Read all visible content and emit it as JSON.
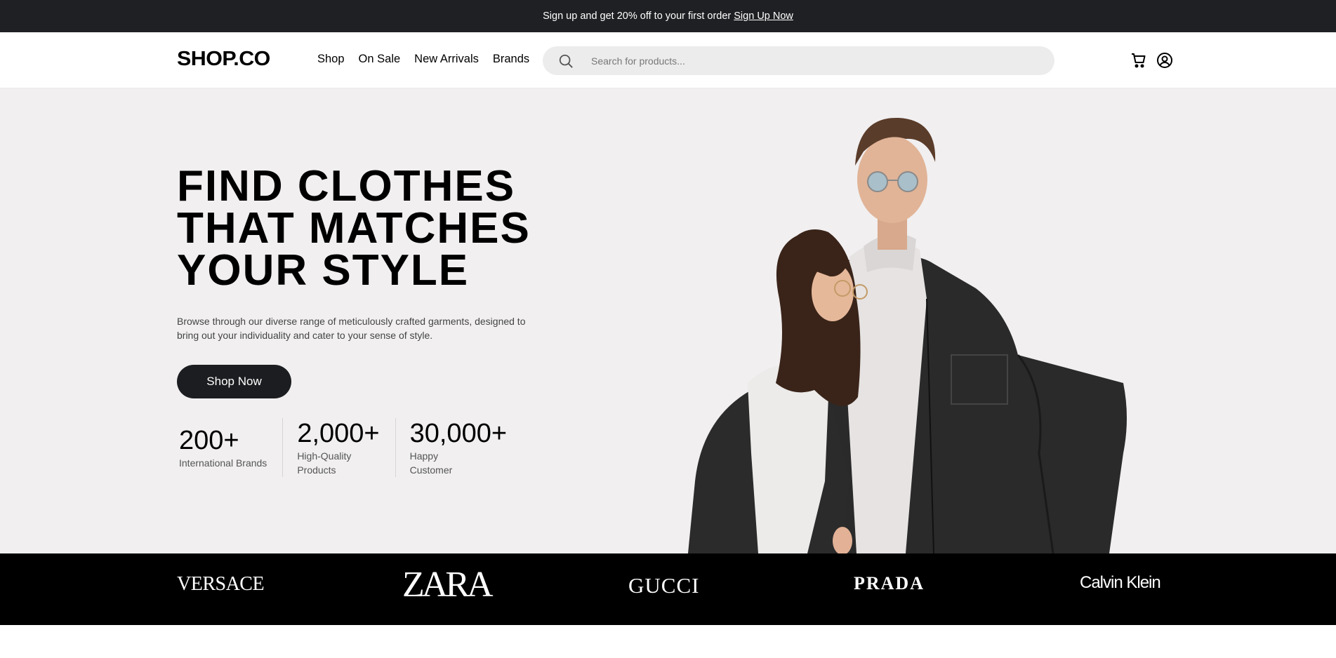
{
  "promo": {
    "text": "Sign up and get 20% off to your first order",
    "link": "Sign Up Now"
  },
  "header": {
    "logo": "SHOP.CO",
    "nav": [
      "Shop",
      "On Sale",
      "New Arrivals",
      "Brands"
    ],
    "search_placeholder": "Search for products...",
    "icons": [
      "cart-icon",
      "account-icon"
    ]
  },
  "hero": {
    "title_lines": [
      "FIND CLOTHES",
      "THAT MATCHES",
      "YOUR STYLE"
    ],
    "description": "Browse through our diverse range of meticulously crafted garments, designed to bring out your individuality and cater to your sense of style.",
    "cta": "Shop Now",
    "stats": [
      {
        "value": "200+",
        "label": "International Brands"
      },
      {
        "value": "2,000+",
        "label": "High-Quality Products"
      },
      {
        "value": "30,000+",
        "label": "Happy Customer"
      }
    ]
  },
  "brands": [
    "VERSACE",
    "ZARA",
    "GUCCI",
    "PRADA",
    "Calvin Klein"
  ],
  "colors": {
    "promo_bg": "#1f2023",
    "hero_bg": "#f1eff0",
    "brand_strip_bg": "#000000",
    "button_bg": "#1c1d20"
  }
}
